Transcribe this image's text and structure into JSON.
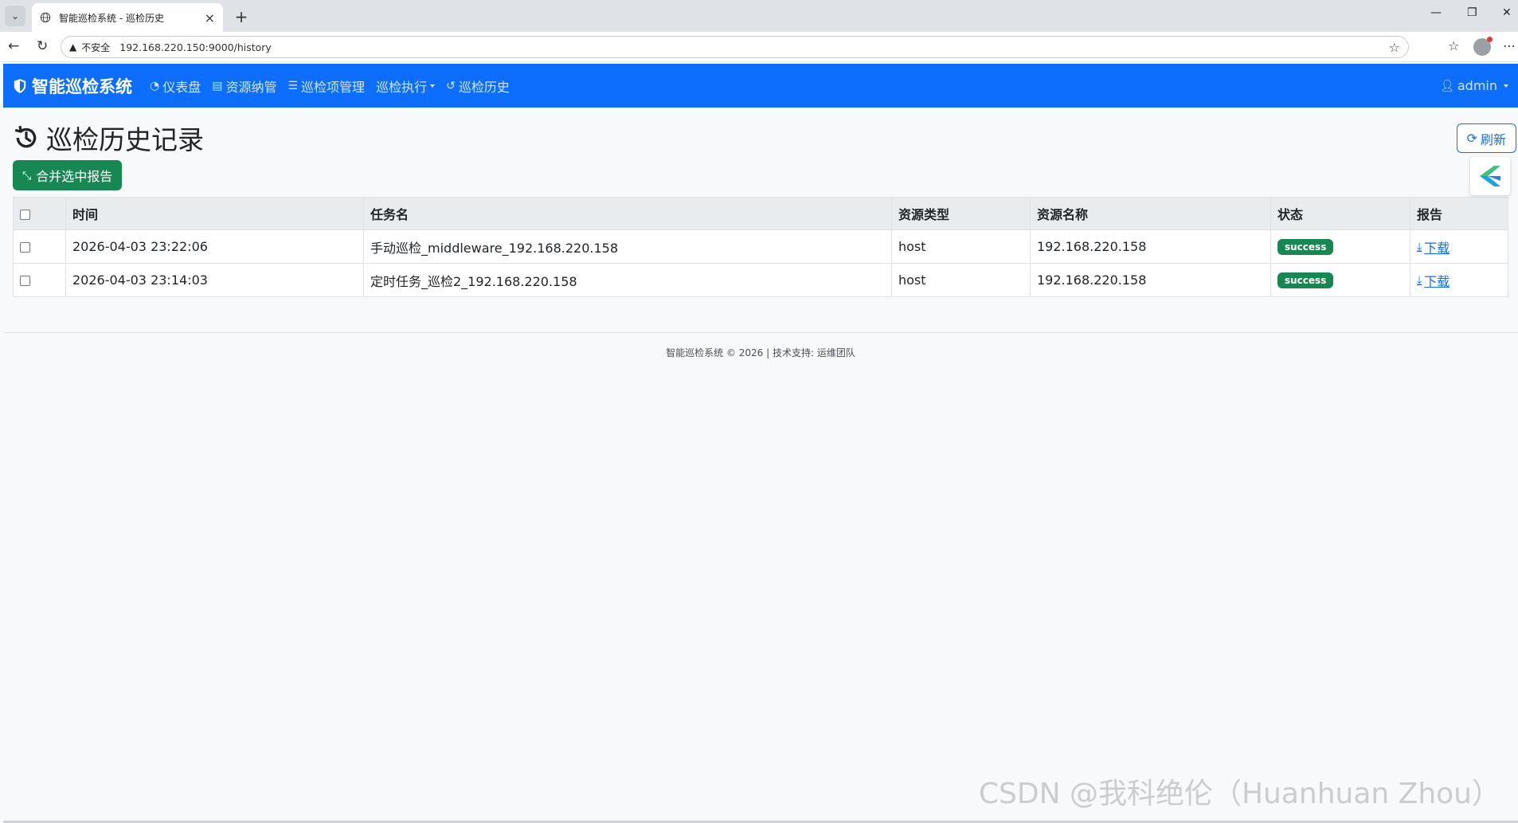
{
  "browser": {
    "tab_title": "智能巡检系统 - 巡检历史",
    "url_insecure": "不安全",
    "url": "192.168.220.150:9000/history"
  },
  "navbar": {
    "brand": "智能巡检系统",
    "items": [
      {
        "label": "仪表盘",
        "icon": "dashboard-icon"
      },
      {
        "label": "资源纳管",
        "icon": "database-icon"
      },
      {
        "label": "巡检项管理",
        "icon": "list-icon"
      },
      {
        "label": "巡检执行",
        "icon": "",
        "dropdown": true
      },
      {
        "label": "巡检历史",
        "icon": "history-icon"
      }
    ],
    "user": "admin"
  },
  "page": {
    "title": "巡检历史记录",
    "refresh_label": "刷新",
    "merge_label": "合并选中报告"
  },
  "table": {
    "headers": [
      "时间",
      "任务名",
      "资源类型",
      "资源名称",
      "状态",
      "报告"
    ],
    "rows": [
      {
        "time": "2026-04-03 23:22:06",
        "task": "手动巡检_middleware_192.168.220.158",
        "type": "host",
        "name": "192.168.220.158",
        "status": "success",
        "report": "下载"
      },
      {
        "time": "2026-04-03 23:14:03",
        "task": "定时任务_巡检2_192.168.220.158",
        "type": "host",
        "name": "192.168.220.158",
        "status": "success",
        "report": "下载"
      }
    ]
  },
  "footer": "智能巡检系统 © 2026 | 技术支持: 运维团队",
  "watermark": "CSDN @我科绝伦（Huanhuan Zhou）",
  "colors": {
    "primary": "#0d6efd",
    "success": "#198754"
  }
}
